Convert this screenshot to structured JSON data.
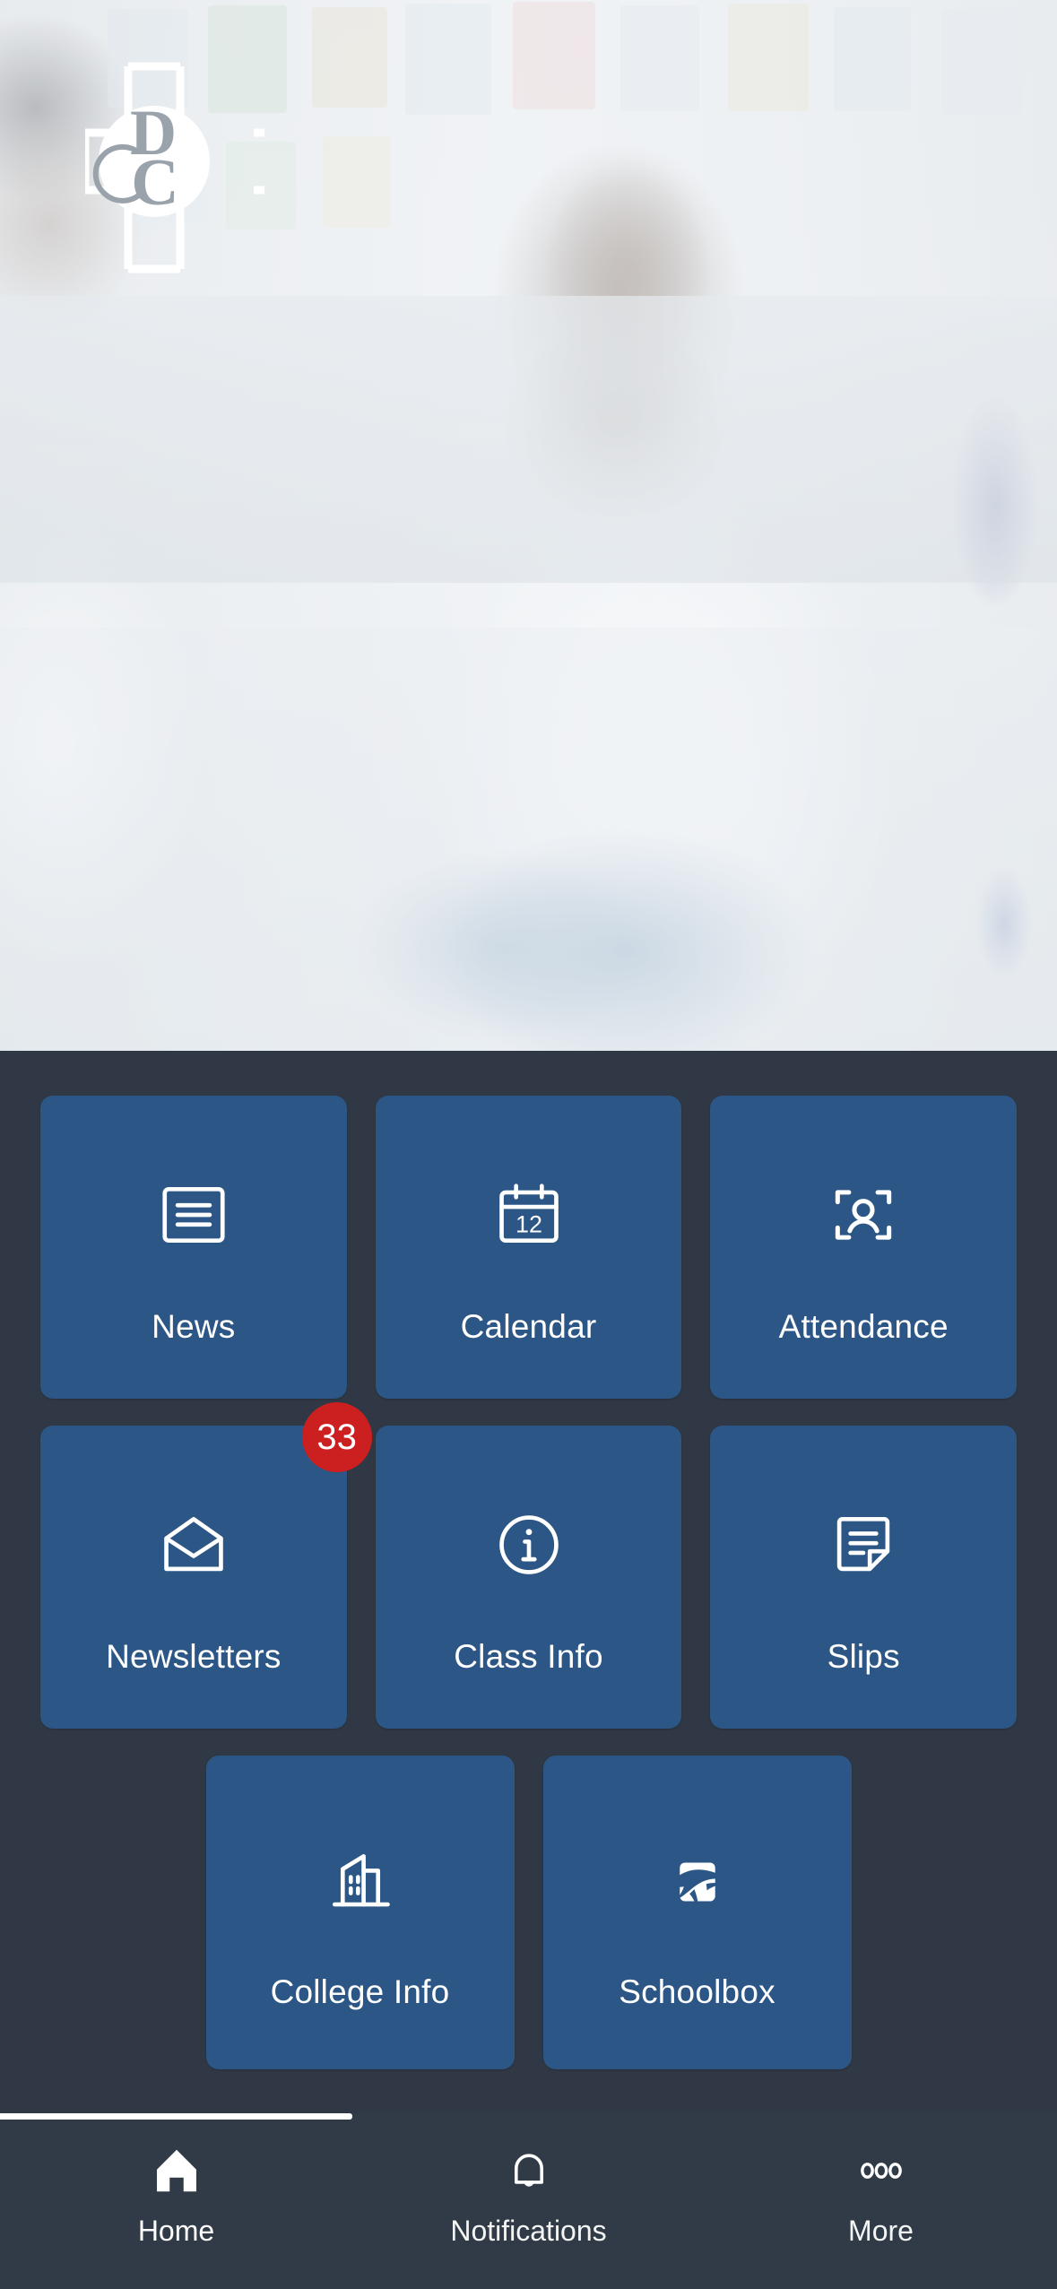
{
  "app": {
    "background_color": "#303845",
    "tile_color": "#2b5685",
    "badge_color": "#cc1f1f",
    "accent_white": "#ffffff"
  },
  "hero": {
    "logo_alt": "DC college crest logo",
    "logo_letters": "DC"
  },
  "grid": {
    "rows": [
      {
        "tiles": [
          {
            "label": "News",
            "icon": "news-lines-icon"
          },
          {
            "label": "Calendar",
            "icon": "calendar-icon",
            "icon_text": "12"
          },
          {
            "label": "Attendance",
            "icon": "attendance-scan-person-icon"
          }
        ]
      },
      {
        "tiles": [
          {
            "label": "Newsletters",
            "icon": "envelope-open-icon",
            "badge": "33"
          },
          {
            "label": "Class Info",
            "icon": "info-circle-icon"
          },
          {
            "label": "Slips",
            "icon": "document-folded-corner-icon"
          }
        ]
      },
      {
        "tiles": [
          {
            "label": "College Info",
            "icon": "building-icon"
          },
          {
            "label": "Schoolbox",
            "icon": "schoolbox-marlin-icon"
          }
        ]
      }
    ]
  },
  "bottom_nav": {
    "items": [
      {
        "label": "Home",
        "icon": "home-filled-icon",
        "active": true
      },
      {
        "label": "Notifications",
        "icon": "bell-outline-icon",
        "active": false
      },
      {
        "label": "More",
        "icon": "more-dots-icon",
        "active": false
      }
    ]
  }
}
